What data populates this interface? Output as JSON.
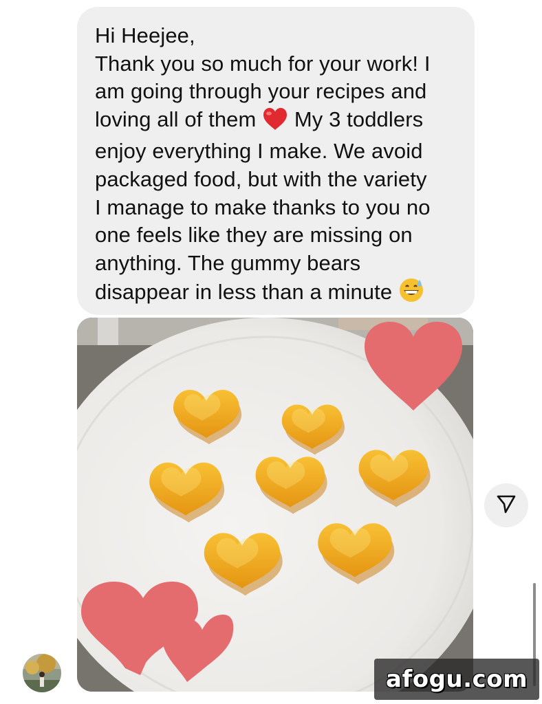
{
  "message": {
    "lines": [
      "Hi Heejee,",
      "Thank you so much for your work! I",
      "am going through your recipes and",
      "loving all of them",
      "My 3 toddlers",
      "enjoy everything I make. We avoid",
      "packaged food, but with the variety",
      "I manage to make thanks to you no",
      "one feels like they are missing on",
      "anything. The gummy bears",
      "disappear in less than a minute"
    ],
    "emojis": [
      "red-heart",
      "grinning-sweat-face"
    ]
  },
  "photo": {
    "subject": "heart-shaped-gummies-on-plate",
    "stickers": [
      "heart-sticker",
      "heart-sticker",
      "heart-sticker"
    ],
    "colors": {
      "plate": "#f2f1ef",
      "gummy": "#f2a81c",
      "sticker": "#e46b6e"
    }
  },
  "actions": {
    "share_icon": "paper-plane-icon"
  },
  "watermark": {
    "text": "afogu.com"
  },
  "colors": {
    "bubble": "#efefef",
    "text": "#111111"
  }
}
